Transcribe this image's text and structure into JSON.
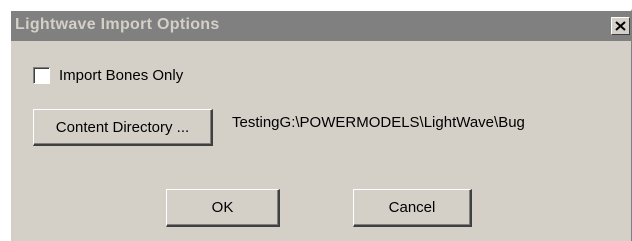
{
  "window": {
    "title": "Lightwave Import Options",
    "close_icon": "close-x-icon"
  },
  "options": {
    "import_bones_only_label": "Import Bones Only",
    "import_bones_only_checked": false
  },
  "content_directory": {
    "button_label": "Content Directory ...",
    "path": "TestingG:\\POWERMODELS\\LightWave\\Bug"
  },
  "actions": {
    "ok_label": "OK",
    "cancel_label": "Cancel"
  }
}
